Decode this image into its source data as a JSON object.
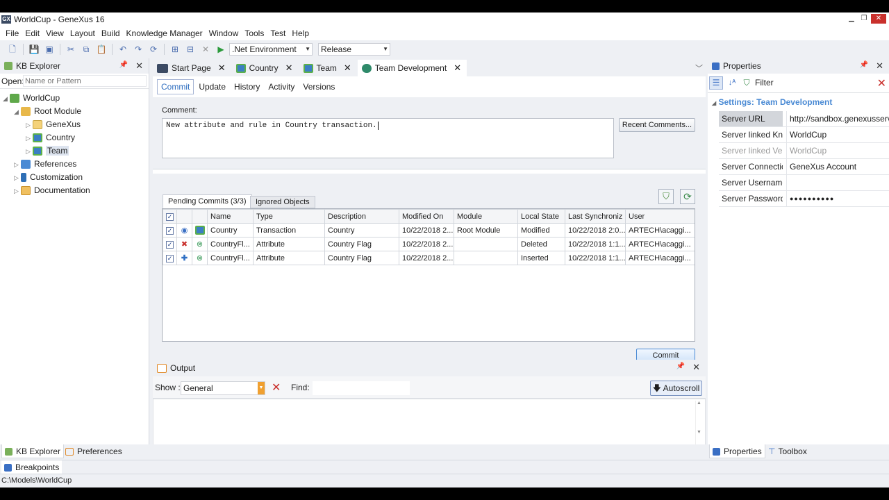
{
  "window": {
    "title": "WorldCup - GeneXus 16",
    "logo": "GX"
  },
  "menu": [
    "File",
    "Edit",
    "View",
    "Layout",
    "Build",
    "Knowledge Manager",
    "Window",
    "Tools",
    "Test",
    "Help"
  ],
  "toolbar": {
    "environment": ".Net Environment",
    "configuration": "Release"
  },
  "kb_explorer": {
    "title": "KB Explorer",
    "open_label": "Open:",
    "open_placeholder": "Name or Pattern",
    "tree": {
      "root": "WorldCup",
      "root_module": "Root Module",
      "genexus": "GeneXus",
      "country": "Country",
      "team": "Team",
      "references": "References",
      "customization": "Customization",
      "documentation": "Documentation"
    }
  },
  "doc_tabs": {
    "start_page": "Start Page",
    "country": "Country",
    "team": "Team",
    "team_dev": "Team Development"
  },
  "sub_tabs": {
    "commit": "Commit",
    "update": "Update",
    "history": "History",
    "activity": "Activity",
    "versions": "Versions"
  },
  "comment": {
    "label": "Comment:",
    "value": "New attribute and rule in Country transaction.",
    "recent_button": "Recent Comments..."
  },
  "pending": {
    "tab_pending": "Pending Commits (3/3)",
    "tab_ignored": "Ignored Objects",
    "columns": {
      "name": "Name",
      "type": "Type",
      "description": "Description",
      "modified": "Modified On",
      "module": "Module",
      "state": "Local State",
      "sync": "Last Synchroniz",
      "user": "User"
    },
    "rows": [
      {
        "name": "Country",
        "type": "Transaction",
        "description": "Country",
        "modified": "10/22/2018 2...",
        "module": "Root Module",
        "state": "Modified",
        "sync": "10/22/2018 2:0...",
        "user": "ARTECH\\acaggi..."
      },
      {
        "name": "CountryFl...",
        "type": "Attribute",
        "description": "Country Flag",
        "modified": "10/22/2018 2...",
        "module": "",
        "state": "Deleted",
        "sync": "10/22/2018 1:1...",
        "user": "ARTECH\\acaggi..."
      },
      {
        "name": "CountryFl...",
        "type": "Attribute",
        "description": "Country Flag",
        "modified": "10/22/2018 2...",
        "module": "",
        "state": "Inserted",
        "sync": "10/22/2018 1:1...",
        "user": "ARTECH\\acaggi..."
      }
    ],
    "commit_button": "Commit"
  },
  "output": {
    "title": "Output",
    "show_label": "Show :",
    "show_value": "General",
    "find_label": "Find:",
    "autoscroll": "Autoscroll"
  },
  "properties": {
    "title": "Properties",
    "filter": "Filter",
    "section": "Settings: Team Development",
    "rows": {
      "url_k": "Server URL",
      "url_v": "http://sandbox.genexusserver",
      "kb_k": "Server linked Kno",
      "kb_v": "WorldCup",
      "ver_k": "Server linked Vers",
      "ver_v": "WorldCup",
      "conn_k": "Server Connectior",
      "conn_v": "GeneXus Account",
      "user_k": "Server Username",
      "user_v": "",
      "pass_k": "Server Password",
      "pass_v": "●●●●●●●●●●"
    }
  },
  "bottom_tabs": {
    "kb_explorer": "KB Explorer",
    "preferences": "Preferences",
    "properties": "Properties",
    "toolbox": "Toolbox",
    "breakpoints": "Breakpoints"
  },
  "status": {
    "path": "C:\\Models\\WorldCup"
  }
}
